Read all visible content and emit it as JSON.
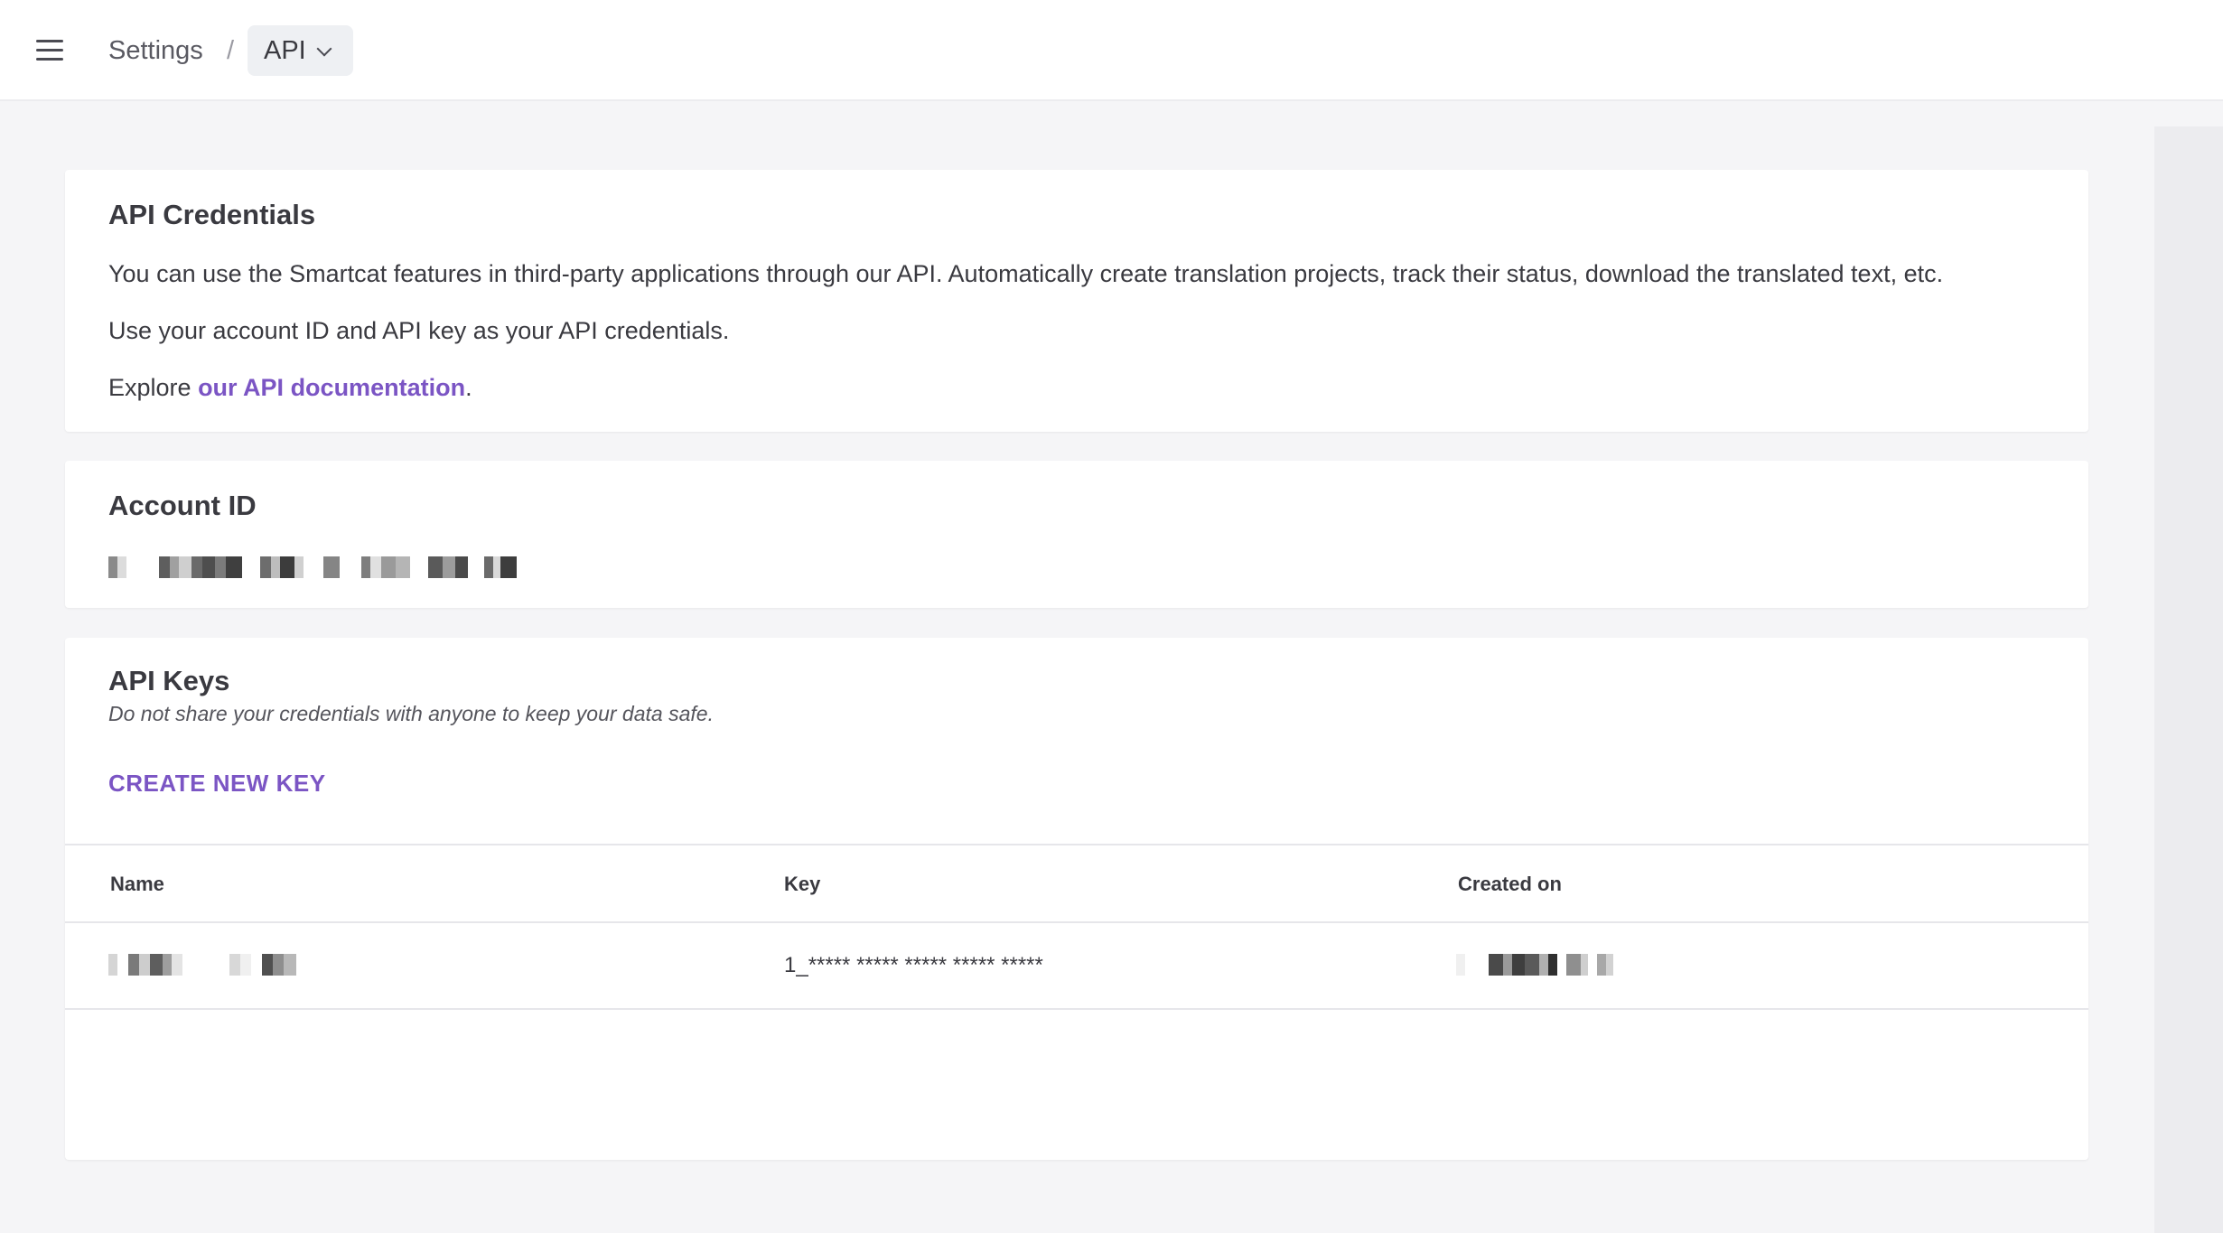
{
  "header": {
    "breadcrumb_root": "Settings",
    "breadcrumb_separator": "/",
    "breadcrumb_current": "API"
  },
  "credentials": {
    "title": "API Credentials",
    "description": "You can use the Smartcat features in third-party applications through our API. Automatically create translation projects, track their status, download the translated text, etc.",
    "usage": "Use your account ID and API key as your API credentials.",
    "explore_prefix": "Explore ",
    "explore_link": "our API documentation",
    "explore_suffix": "."
  },
  "account": {
    "title": "Account ID",
    "value_state": "redacted"
  },
  "api_keys": {
    "title": "API Keys",
    "subtitle": "Do not share your credentials with anyone to keep your data safe.",
    "create_label": "CREATE NEW KEY",
    "columns": [
      "Name",
      "Key",
      "Created on"
    ],
    "rows": [
      {
        "key": "1_***** ***** ***** ***** *****"
      }
    ]
  },
  "colors": {
    "accent": "#7b55c4",
    "background": "#f5f5f7",
    "card": "#ffffff"
  }
}
